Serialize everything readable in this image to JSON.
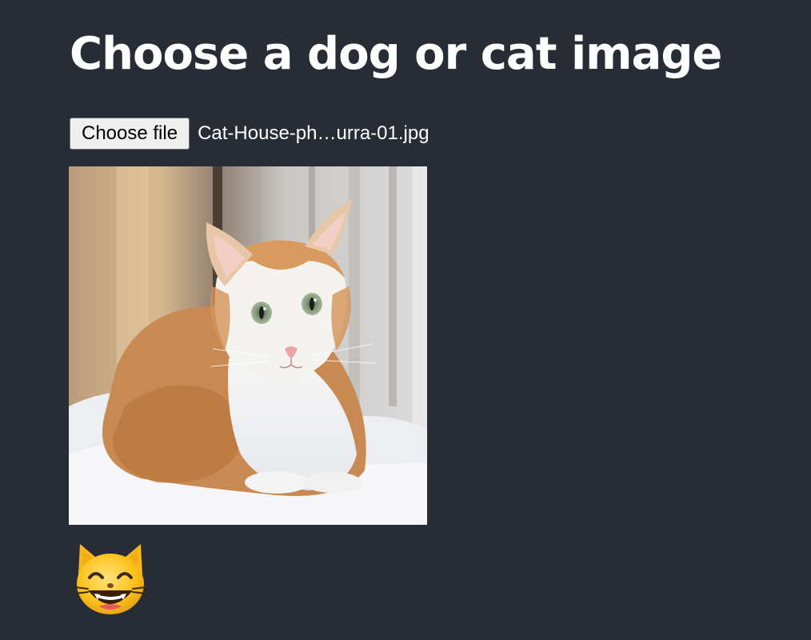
{
  "page": {
    "title": "Choose a dog or cat image"
  },
  "file_input": {
    "button_label": "Choose file",
    "file_name": "Cat-House-ph…urra-01.jpg"
  },
  "preview": {
    "subject": "cat-photo"
  },
  "result": {
    "icon": "grinning-cat-emoji-icon"
  },
  "colors": {
    "background": "#282c35",
    "text": "#ffffff",
    "button_bg": "#efefef",
    "button_border": "#767676"
  }
}
